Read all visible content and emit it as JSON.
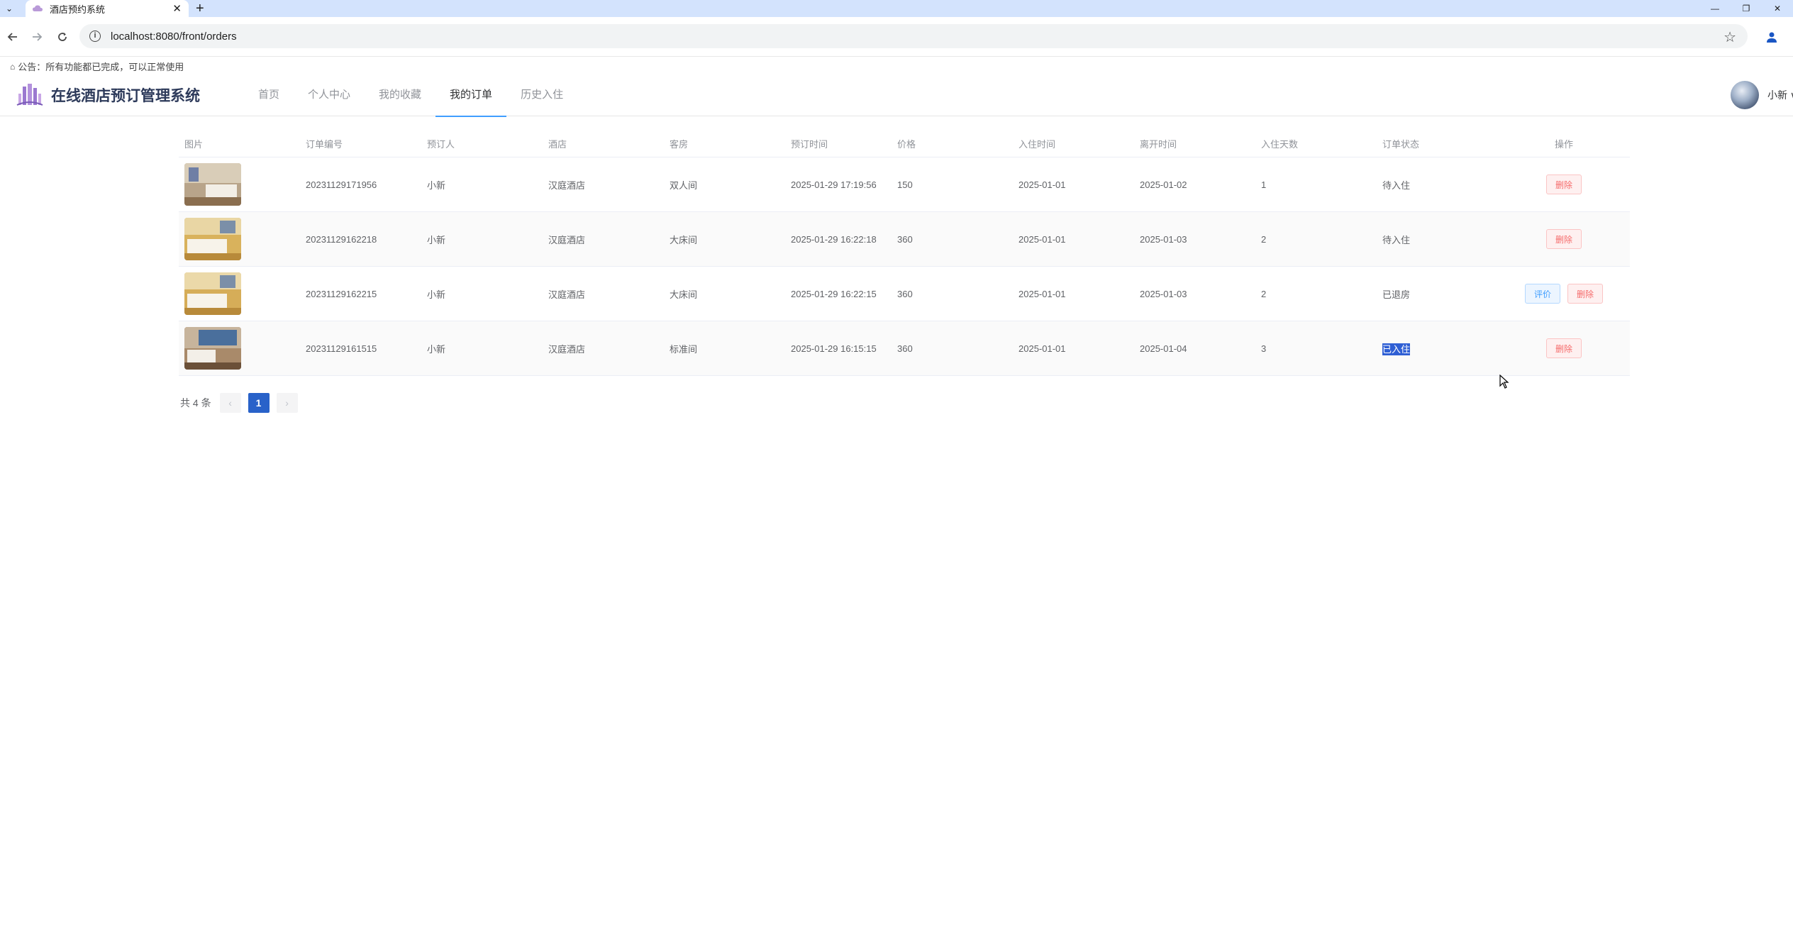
{
  "browser": {
    "tab_title": "酒店预约系统",
    "tab_close": "✕",
    "new_tab": "+",
    "url": "localhost:8080/front/orders",
    "win_minimize": "—",
    "win_restore": "❐",
    "win_close": "✕"
  },
  "notice": {
    "icon": "bell-icon",
    "text": "公告：所有功能都已完成，可以正常使用"
  },
  "header": {
    "site_title": "在线酒店预订管理系统",
    "menu": [
      {
        "label": "首页"
      },
      {
        "label": "个人中心"
      },
      {
        "label": "我的收藏"
      },
      {
        "label": "我的订单"
      },
      {
        "label": "历史入住"
      }
    ],
    "active_menu": "我的订单",
    "user_name": "小新 ∨"
  },
  "table": {
    "headers": {
      "image": "图片",
      "order_no": "订单编号",
      "booker": "预订人",
      "hotel": "酒店",
      "room": "客房",
      "book_time": "预订时间",
      "price": "价格",
      "check_in": "入住时间",
      "check_out": "离开时间",
      "days": "入住天数",
      "status": "订单状态",
      "actions": "操作"
    },
    "rows": [
      {
        "order_no": "20231129171956",
        "booker": "小新",
        "hotel": "汉庭酒店",
        "room": "双人间",
        "book_time": "2025-01-29 17:19:56",
        "price": "150",
        "check_in": "2025-01-01",
        "check_out": "2025-01-02",
        "days": "1",
        "status": "待入住",
        "delete": "删除"
      },
      {
        "order_no": "20231129162218",
        "booker": "小新",
        "hotel": "汉庭酒店",
        "room": "大床间",
        "book_time": "2025-01-29 16:22:18",
        "price": "360",
        "check_in": "2025-01-01",
        "check_out": "2025-01-03",
        "days": "2",
        "status": "待入住",
        "delete": "删除"
      },
      {
        "order_no": "20231129162215",
        "booker": "小新",
        "hotel": "汉庭酒店",
        "room": "大床间",
        "book_time": "2025-01-29 16:22:15",
        "price": "360",
        "check_in": "2025-01-01",
        "check_out": "2025-01-03",
        "days": "2",
        "status": "已退房",
        "review": "评价",
        "delete": "删除"
      },
      {
        "order_no": "20231129161515",
        "booker": "小新",
        "hotel": "汉庭酒店",
        "room": "标准间",
        "book_time": "2025-01-29 16:15:15",
        "price": "360",
        "check_in": "2025-01-01",
        "check_out": "2025-01-04",
        "days": "3",
        "status": "已入住",
        "delete": "删除"
      }
    ]
  },
  "pagination": {
    "total_text": "共 4 条",
    "prev": "‹",
    "current_page": "1",
    "next": "›"
  }
}
